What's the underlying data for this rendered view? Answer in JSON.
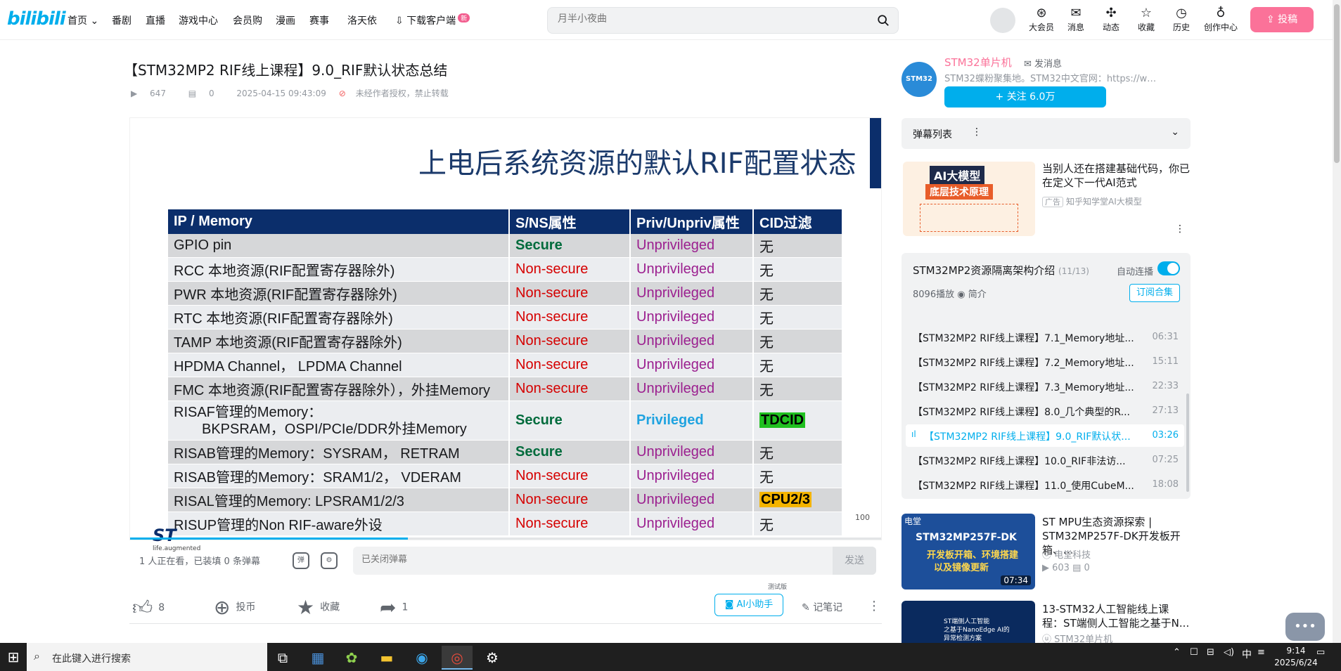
{
  "header": {
    "nav": [
      {
        "label": "首页"
      },
      {
        "label": "番剧"
      },
      {
        "label": "直播"
      },
      {
        "label": "游戏中心"
      },
      {
        "label": "会员购"
      },
      {
        "label": "漫画"
      },
      {
        "label": "赛事"
      },
      {
        "label": "洛天依"
      },
      {
        "label": "下载客户端"
      }
    ],
    "new_badge": "新",
    "search_placeholder": "月半小夜曲",
    "right_icons": [
      {
        "label": "大会员",
        "icon": "vip-icon"
      },
      {
        "label": "消息",
        "icon": "message-icon"
      },
      {
        "label": "动态",
        "icon": "dynamic-icon"
      },
      {
        "label": "收藏",
        "icon": "favorite-icon"
      },
      {
        "label": "历史",
        "icon": "history-icon"
      },
      {
        "label": "创作中心",
        "icon": "creator-icon"
      }
    ],
    "upload_label": "投稿",
    "accent": "#00aeec",
    "pink": "#fb7299"
  },
  "video": {
    "title": "【STM32MP2 RIF线上课程】9.0_RIF默认状态总结",
    "views": "647",
    "danmaku": "0",
    "date": "2025-04-15 09:43:09",
    "notice": "未经作者授权，禁止转载",
    "progress_percent": 37
  },
  "slide": {
    "title": "上电后系统资源的默认RIF配置状态",
    "headers": [
      "IP / Memory",
      "S/NS属性",
      "Priv/Unpriv属性",
      "CID过滤"
    ],
    "rows": [
      {
        "ip": "GPIO pin",
        "sns": "Secure",
        "priv": "Unprivileged",
        "cid": "无"
      },
      {
        "ip": "RCC 本地资源(RIF配置寄存器除外)",
        "sns": "Non-secure",
        "priv": "Unprivileged",
        "cid": "无"
      },
      {
        "ip": "PWR 本地资源(RIF配置寄存器除外)",
        "sns": "Non-secure",
        "priv": "Unprivileged",
        "cid": "无"
      },
      {
        "ip": "RTC 本地资源(RIF配置寄存器除外)",
        "sns": "Non-secure",
        "priv": "Unprivileged",
        "cid": "无"
      },
      {
        "ip": "TAMP 本地资源(RIF配置寄存器除外)",
        "sns": "Non-secure",
        "priv": "Unprivileged",
        "cid": "无"
      },
      {
        "ip": "HPDMA Channel， LPDMA Channel",
        "sns": "Non-secure",
        "priv": "Unprivileged",
        "cid": "无"
      },
      {
        "ip": "FMC 本地资源(RIF配置寄存器除外），外挂Memory",
        "sns": "Non-secure",
        "priv": "Unprivileged",
        "cid": "无"
      },
      {
        "ip": "RISAF管理的Memory：",
        "ip2": "BKPSRAM，OSPI/PCIe/DDR外挂Memory",
        "sns": "Secure",
        "priv": "Privileged",
        "cid": "TDCID"
      },
      {
        "ip": "RISAB管理的Memory：SYSRAM， RETRAM",
        "sns": "Secure",
        "priv": "Unprivileged",
        "cid": "无"
      },
      {
        "ip": "RISAB管理的Memory：SRAM1/2， VDERAM",
        "sns": "Non-secure",
        "priv": "Unprivileged",
        "cid": "无"
      },
      {
        "ip": "RISAL管理的Memory: LPSRAM1/2/3",
        "sns": "Non-secure",
        "priv": "Unprivileged",
        "cid": "CPU2/3"
      },
      {
        "ip": "RISUP管理的Non RIF-aware外设",
        "sns": "Non-secure",
        "priv": "Unprivileged",
        "cid": "无"
      }
    ],
    "footer_logo_text": "life.augmented",
    "page_number": "100"
  },
  "danmaku_bar": {
    "status": "1 人正在看，已装填 0 条弹幕",
    "input_placeholder": "已关闭弹幕",
    "send_label": "发送"
  },
  "actions": {
    "like_count": "8",
    "coin_label": "投币",
    "favorite_label": "收藏",
    "share_count": "1",
    "ai_label": "AI小助手",
    "ai_badge": "测试版",
    "notes_label": "记笔记"
  },
  "uploader": {
    "name": "STM32单片机",
    "message_label": "发消息",
    "desc": "STM32蝶粉聚集地。STM32中文官网：https://www.st...",
    "follow_label": "+ 关注 6.0万",
    "avatar_text": "STM32"
  },
  "danmaku_list": {
    "label": "弹幕列表"
  },
  "ad": {
    "title": "当别人还在搭建基础代码，你已在定义下一代AI范式",
    "tag": "广告",
    "source": "知乎知学堂AI大模型",
    "thumb_line1": "AI大模型",
    "thumb_line2": "底层技术原理"
  },
  "playlist": {
    "title": "STM32MP2资源隔离架构介绍",
    "count": "(11/13)",
    "autoplay_label": "自动连播",
    "views": "8096播放",
    "intro_label": "简介",
    "subscribe_label": "订阅合集",
    "items": [
      {
        "title": "【STM32MP2 RIF线上课程】7.1_Memory地址...",
        "duration": "06:31"
      },
      {
        "title": "【STM32MP2 RIF线上课程】7.2_Memory地址...",
        "duration": "15:11"
      },
      {
        "title": "【STM32MP2 RIF线上课程】7.3_Memory地址...",
        "duration": "22:33"
      },
      {
        "title": "【STM32MP2 RIF线上课程】8.0_几个典型的R...",
        "duration": "27:13"
      },
      {
        "title": "【STM32MP2 RIF线上课程】9.0_RIF默认状...",
        "duration": "03:26"
      },
      {
        "title": "【STM32MP2 RIF线上课程】10.0_RIF非法访...",
        "duration": "07:25"
      },
      {
        "title": "【STM32MP2 RIF线上课程】11.0_使用CubeM...",
        "duration": "18:08"
      }
    ]
  },
  "recommendations": [
    {
      "title": "ST MPU生态资源探索 | STM32MP257F-DK开发板开箱、...",
      "up": "电堂科技",
      "views": "603",
      "danmaku": "0",
      "duration": "07:34",
      "thumb_text": "STM32MP257F-DK",
      "thumb_sub": "开发板开箱、环境搭建",
      "thumb_sub2": "以及镜像更新",
      "corner": "电堂"
    },
    {
      "title": "13-STM32人工智能线上课程：ST端侧人工智能之基于N...",
      "up": "STM32单片机",
      "thumb_text": "ST端侧人工智能",
      "thumb_sub": "之基于NanoEdge AI的",
      "thumb_sub2": "异常检测方案"
    }
  ],
  "taskbar": {
    "search_placeholder": "在此键入进行搜索",
    "ime": "中",
    "time": "9:14",
    "date": "2025/6/24"
  }
}
